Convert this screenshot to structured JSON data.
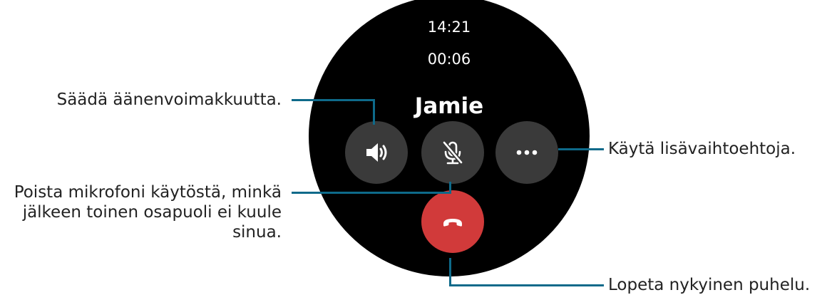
{
  "watch": {
    "clock": "14:21",
    "duration": "00:06",
    "caller": "Jamie"
  },
  "buttons": {
    "volume_icon": "speaker-icon",
    "mute_icon": "mic-off-icon",
    "more_icon": "more-dots-icon",
    "end_icon": "end-call-icon"
  },
  "annotations": {
    "volume": "Säädä äänenvoimakkuutta.",
    "mute_line1": "Poista mikrofoni käytöstä, minkä",
    "mute_line2": "jälkeen toinen osapuoli ei kuule",
    "mute_line3": "sinua.",
    "more": "Käytä lisävaihtoehtoja.",
    "end": "Lopeta nykyinen puhelu."
  },
  "colors": {
    "watch_bg": "#000000",
    "button_bg": "#3a3a3a",
    "end_call": "#d13a3a",
    "leader_line": "#0e6a8a"
  }
}
